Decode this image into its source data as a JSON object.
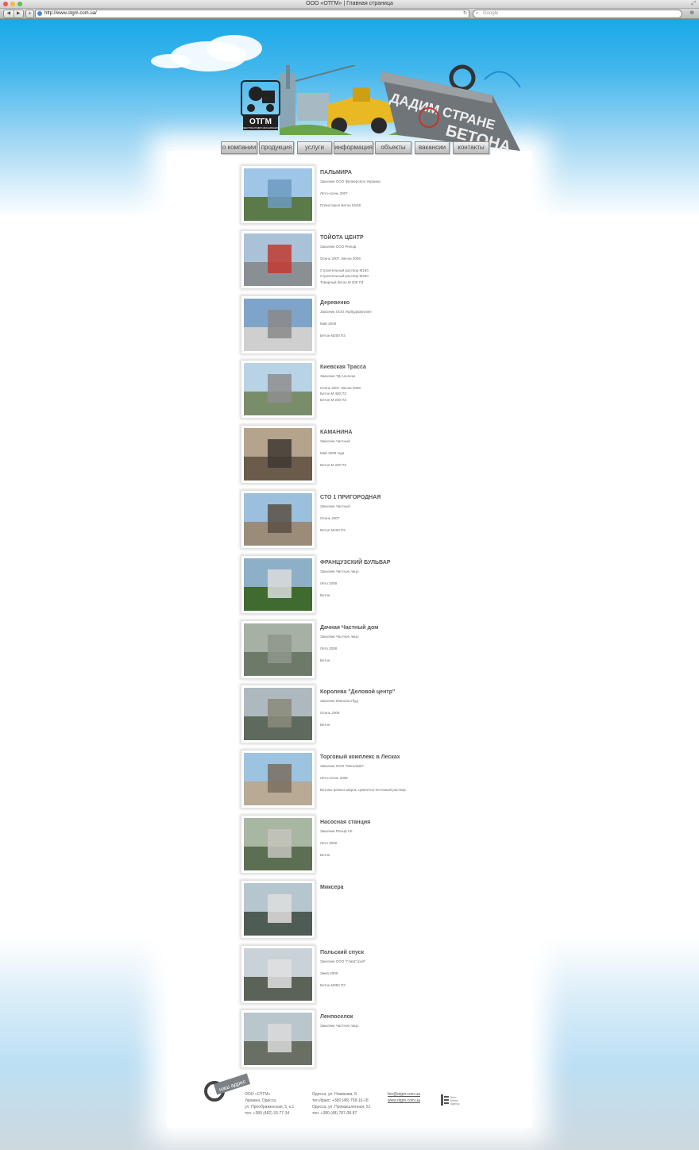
{
  "window": {
    "title": "ООО «ОТГМ» | Главная страница"
  },
  "browser": {
    "url": "http://www.otgm.com.ua/",
    "search_placeholder": "Google"
  },
  "header": {
    "logo_text": "ОТГМ",
    "logo_subtext": "ОДЕСТРАНСГИДРО МЕХАНИЗАЦИЯ",
    "slogan_line1": "ДАДИМ СТРАНЕ",
    "slogan_line2": "БЕТОНА"
  },
  "nav": {
    "items": [
      {
        "label": "о компании"
      },
      {
        "label": "продукция"
      },
      {
        "label": "услуги"
      },
      {
        "label": "информация"
      },
      {
        "label": "объекты"
      },
      {
        "label": "вакансии"
      },
      {
        "label": "контакты"
      }
    ]
  },
  "projects": [
    {
      "title": "ПАЛЬМИРА",
      "lines": [
        "Заказчик ООО Фелиерселл Украина",
        "",
        "Лето-осень 2007",
        "",
        "Полистирол Бетон М150"
      ]
    },
    {
      "title": "ТОЙОТА ЦЕНТР",
      "lines": [
        "Заказчик ООО Рельф",
        "",
        "Осень 2007, Весна 2008",
        "",
        "Строительный раствор М150",
        "Строительный раствор М200",
        "Товарный бетон М 200 П3"
      ]
    },
    {
      "title": "Деревенко",
      "lines": [
        "Заказчик ООО Укрбудкомплект",
        "",
        "Май 2008",
        "",
        "Бетон М200 П3"
      ]
    },
    {
      "title": "Киевская Трасса",
      "lines": [
        "Заказчик ТД Альтком",
        "",
        "Осень 2007, Весна 2008",
        "Бетон М 400 П2",
        "Бетон М 200 П2"
      ]
    },
    {
      "title": "КАМАНИНА",
      "lines": [
        "Заказчик Частный",
        "",
        "Май 2008 года",
        "",
        "Бетон М 200 П3"
      ]
    },
    {
      "title": "СТО 1 ПРИГОРОДНАЯ",
      "lines": [
        "Заказчик Частный",
        "",
        "Осень 2007",
        "",
        "Бетон М400 П2"
      ]
    },
    {
      "title": "ФРАНЦУЗСКИЙ БУЛЬВАР",
      "lines": [
        "Заказчик Частное лицо",
        "",
        "Лето 2008",
        "",
        "Бетон"
      ]
    },
    {
      "title": "Дачная Частный дом",
      "lines": [
        "Заказчик Частное лицо",
        "",
        "Лето 2008",
        "",
        "Бетон"
      ]
    },
    {
      "title": "Королева \"Деловой центр\"",
      "lines": [
        "Заказчик Южноагстбуд",
        "",
        "Осень 2008",
        "",
        "Бетон"
      ]
    },
    {
      "title": "Торговый комплекс в Лесках",
      "lines": [
        "Заказчик ООО \"Мегалайн\"",
        "",
        "Лето-осень 2008",
        "",
        "Бетоны разных марок, цементно-песчаный раствор"
      ]
    },
    {
      "title": "Насосная станция",
      "lines": [
        "Заказчик Рельф СК",
        "",
        "Лето 2008",
        "",
        "Бетон"
      ]
    },
    {
      "title": "Миксера",
      "lines": []
    },
    {
      "title": "Польский спуск",
      "lines": [
        "Заказчик ООО \"ГлавСтрой\"",
        "",
        "Зима 2009",
        "",
        "Бетон М350 П3"
      ]
    },
    {
      "title": "Ленпоселок",
      "lines": [
        "Заказчик Частное лицо"
      ]
    }
  ],
  "footer": {
    "badge": "наш адрес",
    "col1": [
      "ООО «ОТГМ»",
      "Украина, Одесса,",
      "ул. Преображенская, 5, к.1",
      "тел. +380 (482) 33-77-34"
    ],
    "col2": [
      "Одесса, ул. Новикова, 8",
      "тел./факс: +380 (48) 758-16-18",
      "Одесса, ул. Промышленная, 51",
      "тел. +380 (48) 787-08-87"
    ],
    "col3": [
      "feo@otgm.com.ua",
      "www.otgm.com.ua"
    ],
    "agency": [
      "Rem",
      "Media",
      "Agency"
    ]
  }
}
